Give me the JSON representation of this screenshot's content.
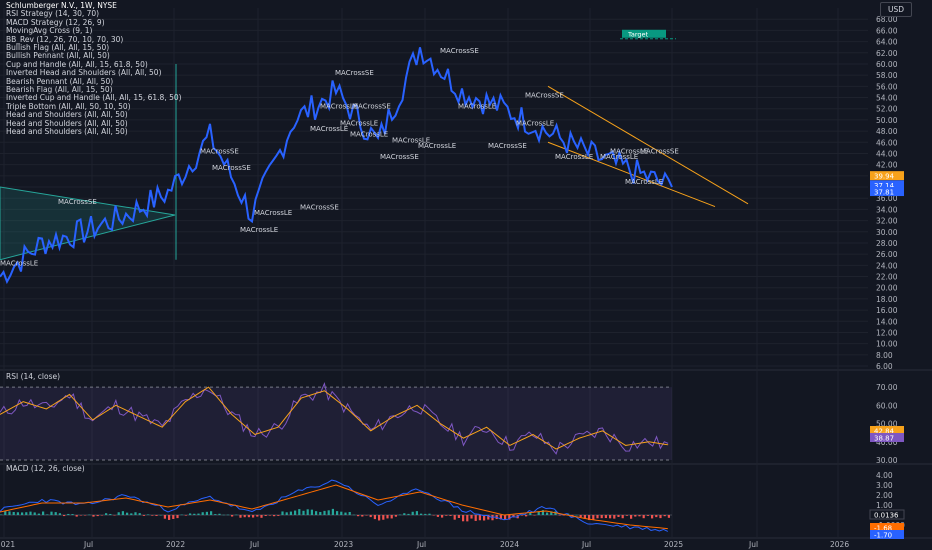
{
  "legend": {
    "title": "Schlumberger N.V., 1W, NYSE",
    "strategies": [
      "RSI Strategy (14, 30, 70)",
      "MACD Strategy (12, 26, 9)",
      "MovingAvg Cross (9, 1)",
      "BB_Rev (12, 26, 70, 10, 70, 30)",
      "Bullish Flag (All, All, 15, 50)",
      "Bullish Pennant (All, All, 50)",
      "Cup and Handle (All, All, 15, 61.8, 50)",
      "Inverted Head and Shoulders (All, All, 50)",
      "Bearish Pennant (All, All, 50)",
      "Bearish Flag (All, All, 15, 50)",
      "Inverted Cup and Handle (All, All, 15, 61.8, 50)",
      "Triple Bottom (All, All, 50, 10, 50)",
      "Head and Shoulders (All, All, 50)",
      "Head and Shoulders (All, All, 50)",
      "Head and Shoulders (All, All, 50)"
    ]
  },
  "currency": "USD",
  "rsi_label": "RSI (14, close)",
  "macd_label": "MACD (12, 26, close)",
  "target_label": "Target",
  "colors": {
    "bg": "#131722",
    "price": "#2962ff",
    "rsi": "#7e57c2",
    "rsi_ma": "#f7a21b",
    "macd": "#2962ff",
    "signal": "#ff6d00",
    "hist_pos": "#26a69a",
    "hist_neg": "#ef5350",
    "channel": "#f7a21b",
    "target": "#089981"
  },
  "chart_data": [
    {
      "type": "line",
      "name": "price",
      "x": [
        "2021-01",
        "2021-04",
        "2021-07",
        "2021-10",
        "2022-01",
        "2022-04",
        "2022-07",
        "2022-10",
        "2023-01",
        "2023-04",
        "2023-07",
        "2023-10",
        "2024-01",
        "2024-04",
        "2024-07",
        "2024-10",
        "2024-12"
      ],
      "values": [
        22,
        28,
        30,
        33,
        37,
        47,
        33,
        50,
        55,
        46,
        63,
        55,
        52,
        48,
        44,
        41,
        38
      ],
      "x_ticks": [
        "2021",
        "Jul",
        "2022",
        "Jul",
        "2023",
        "Jul",
        "2024",
        "Jul",
        "2025",
        "Jul",
        "2026"
      ],
      "y_ticks": [
        "6.00",
        "8.00",
        "10.00",
        "12.00",
        "14.00",
        "16.00",
        "18.00",
        "20.00",
        "22.00",
        "24.00",
        "26.00",
        "28.00",
        "30.00",
        "32.00",
        "34.00",
        "36.00",
        "38.00",
        "40.00",
        "42.00",
        "44.00",
        "46.00",
        "48.00",
        "50.00",
        "52.00",
        "54.00",
        "56.00",
        "58.00",
        "60.00",
        "62.00",
        "64.00",
        "66.00",
        "68.00"
      ],
      "ylim": [
        6,
        70
      ],
      "price_labels": [
        "39.94",
        "37.14",
        "37.81"
      ],
      "annotations": [
        "MACrossLE",
        "MACrossSE",
        "MACrossSE",
        "MACrossLE",
        "MACrossSE",
        "MACrossLE",
        "MACrossSE",
        "MACrossLE",
        "MACrossLE",
        "MACrossSE",
        "MACrossLE",
        "MACrossLE",
        "MACrossSE",
        "MACrossSE",
        "MACrossLE",
        "MACrossLE",
        "MACrossSE",
        "MACrossLE",
        "MACrossSE",
        "MACrossLE",
        "MACrossSE",
        "MACrossLE",
        "MACrossLE",
        "MACrossLE",
        "MACrossSE",
        "MACrossLE"
      ]
    },
    {
      "type": "line",
      "name": "RSI",
      "ylim": [
        30,
        75
      ],
      "y_ticks": [
        "70.00",
        "60.00",
        "50.00",
        "40.00",
        "30.00"
      ],
      "values": [
        55,
        62,
        58,
        66,
        52,
        60,
        54,
        48,
        62,
        70,
        55,
        44,
        48,
        64,
        68,
        58,
        46,
        54,
        60,
        50,
        42,
        48,
        38,
        44,
        36,
        42,
        46,
        38,
        40,
        38
      ],
      "last_values": [
        "42.84",
        "38.87"
      ]
    },
    {
      "type": "bar",
      "name": "MACD",
      "ylim": [
        -2,
        4.5
      ],
      "y_ticks": [
        "4.00",
        "3.00",
        "2.00",
        "1.00",
        "-1.0000"
      ],
      "macd": [
        0.5,
        1.5,
        1.0,
        2.0,
        0.5,
        1.8,
        0.2,
        2.2,
        3.5,
        1.0,
        2.6,
        0.5,
        -0.5,
        0.8,
        -0.8,
        -1.2,
        -1.6
      ],
      "signal": [
        0.3,
        1.2,
        1.2,
        1.7,
        0.8,
        1.5,
        0.6,
        1.8,
        3.0,
        1.5,
        2.3,
        1.0,
        0.0,
        0.4,
        -0.4,
        -1.0,
        -1.4
      ],
      "last_values": [
        "0.0136",
        "-1.68",
        "-1.70"
      ]
    }
  ]
}
